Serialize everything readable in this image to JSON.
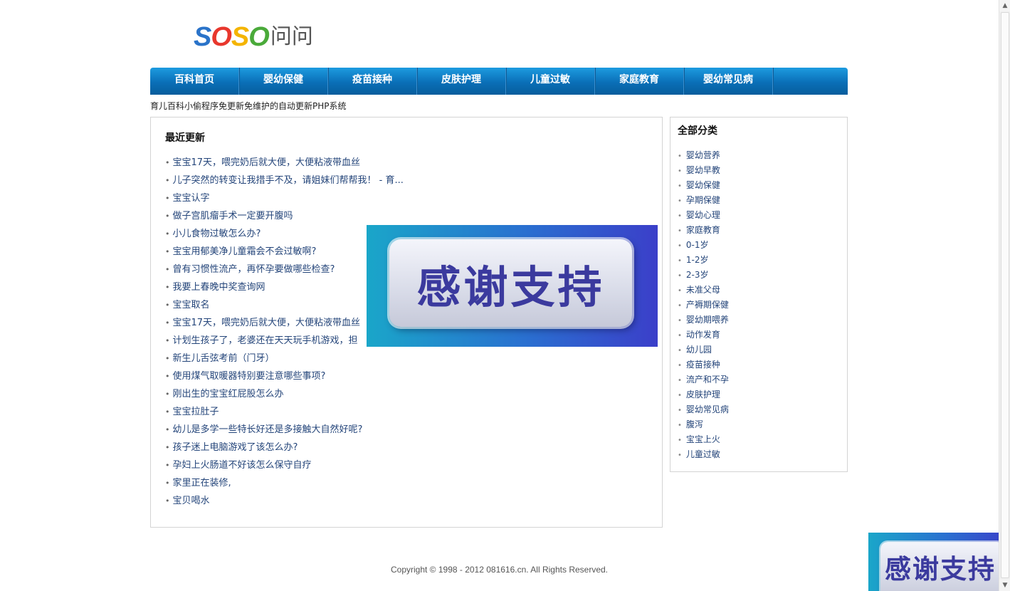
{
  "logo": {
    "brand": [
      "S",
      "O",
      "S",
      "O"
    ],
    "suffix": "问问"
  },
  "nav": {
    "items": [
      "百科首页",
      "婴幼保健",
      "疫苗接种",
      "皮肤护理",
      "儿童过敏",
      "家庭教育",
      "婴幼常见病"
    ]
  },
  "slogan": "育儿百科小偷程序免更新免维护的自动更新PHP系统",
  "main": {
    "title": "最近更新",
    "bullet": "•",
    "articles": [
      "宝宝17天，喂完奶后就大便，大便粘液带血丝",
      "儿子突然的转变让我措手不及，请姐妹们帮帮我！ - 育...",
      "宝宝认字",
      "做子宫肌瘤手术一定要开腹吗",
      "小儿食物过敏怎么办?",
      "宝宝用郁美净儿童霜会不会过敏啊?",
      "曾有习惯性流产，再怀孕要做哪些检查?",
      "我要上春晚中奖查询网",
      "宝宝取名",
      "宝宝17天，喂完奶后就大便，大便粘液带血丝",
      "计划生孩子了，老婆还在天天玩手机游戏，担",
      "新生儿舌弦考前（门牙）",
      "使用煤气取暖器特别要注意哪些事项?",
      "刚出生的宝宝红屁股怎么办",
      "宝宝拉肚子",
      "幼儿是多学一些特长好还是多接触大自然好呢?",
      "孩子迷上电脑游戏了该怎么办?",
      "孕妇上火肠道不好该怎么保守自疗",
      "家里正在装修,",
      "宝贝喝水"
    ]
  },
  "sidebar": {
    "title": "全部分类",
    "bullet": "•",
    "categories": [
      "婴幼营养",
      "婴幼早教",
      "婴幼保健",
      "孕期保健",
      "婴幼心理",
      "家庭教育",
      "0-1岁",
      "1-2岁",
      "2-3岁",
      "未准父母",
      "产褥期保健",
      "婴幼期喂养",
      "动作发育",
      "幼儿园",
      "疫苗接种",
      "流产和不孕",
      "皮肤护理",
      "婴幼常见病",
      "腹泻",
      "宝宝上火",
      "儿童过敏"
    ]
  },
  "footer": "Copyright © 1998 - 2012 081616.cn. All Rights Reserved.",
  "ads": {
    "center_text": "感谢支持",
    "corner_text": "感谢支持"
  },
  "scrollbar": {
    "up_icon": "▲",
    "down_icon": "▼"
  },
  "colors": {
    "nav_blue": "#0a6fb7",
    "link": "#24457a",
    "ad_blue": "#2a6fd0"
  }
}
